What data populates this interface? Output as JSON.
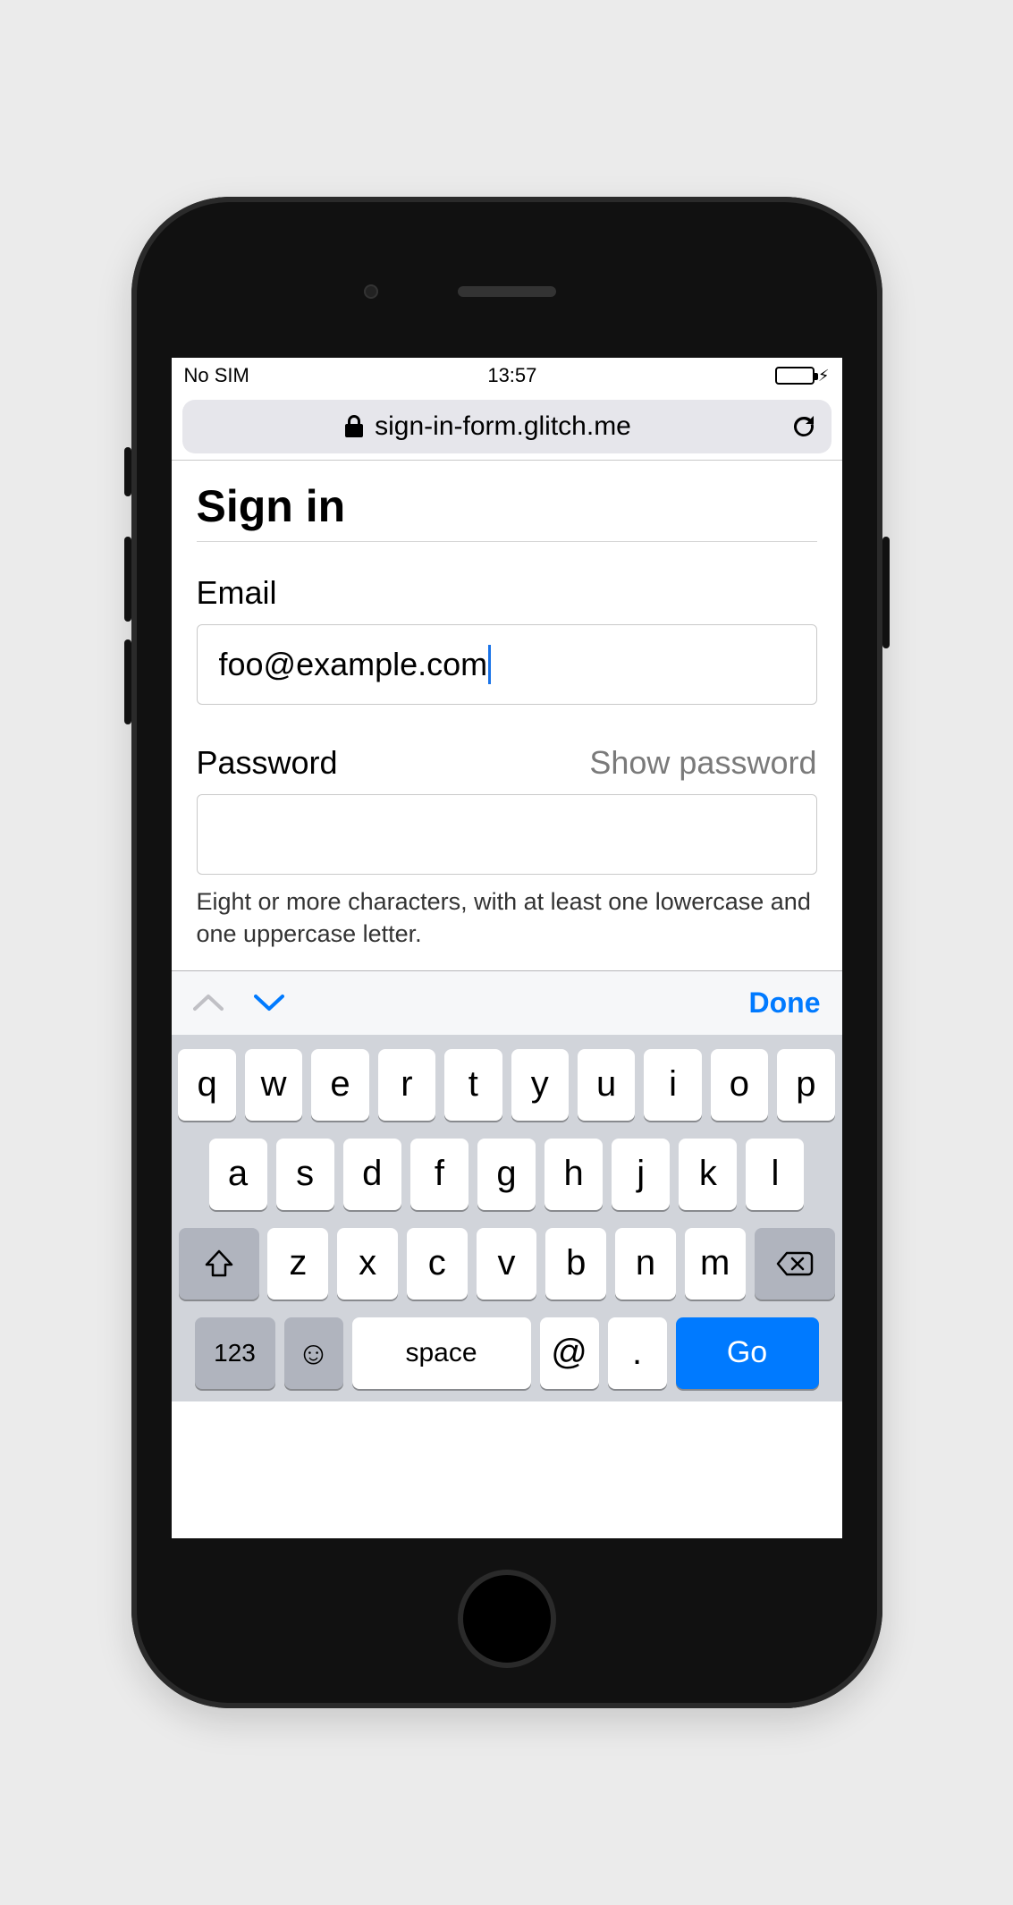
{
  "statusbar": {
    "carrier": "No SIM",
    "time": "13:57"
  },
  "browserbar": {
    "url": "sign-in-form.glitch.me"
  },
  "page": {
    "title": "Sign in",
    "email_label": "Email",
    "email_value": "foo@example.com",
    "password_label": "Password",
    "show_password_label": "Show password",
    "password_value": "",
    "password_helper": "Eight or more characters, with at least one lowercase and one uppercase letter."
  },
  "keyboard_accessory": {
    "done_label": "Done"
  },
  "keyboard": {
    "row1": [
      "q",
      "w",
      "e",
      "r",
      "t",
      "y",
      "u",
      "i",
      "o",
      "p"
    ],
    "row2": [
      "a",
      "s",
      "d",
      "f",
      "g",
      "h",
      "j",
      "k",
      "l"
    ],
    "row3": [
      "z",
      "x",
      "c",
      "v",
      "b",
      "n",
      "m"
    ],
    "numeric_label": "123",
    "space_label": "space",
    "at_label": "@",
    "dot_label": ".",
    "go_label": "Go"
  }
}
